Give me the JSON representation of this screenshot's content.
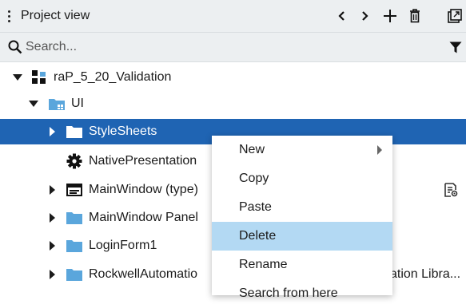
{
  "header": {
    "title": "Project view",
    "actions": [
      "back-icon",
      "forward-icon",
      "add-icon",
      "delete-icon",
      "popout-icon"
    ]
  },
  "search": {
    "placeholder": "Search...",
    "value": ""
  },
  "tree": {
    "items": [
      {
        "label": "raP_5_20_Validation",
        "icon": "project-icon",
        "state": "expanded"
      },
      {
        "label": "UI",
        "icon": "ui-folder-icon",
        "state": "expanded"
      },
      {
        "label": "StyleSheets",
        "icon": "folder-icon",
        "state": "collapsed",
        "selected": true
      },
      {
        "label": "NativePresentation",
        "icon": "gear-icon",
        "state": "leaf"
      },
      {
        "label": "MainWindow (type)",
        "icon": "window-type-icon",
        "state": "collapsed"
      },
      {
        "label": "MainWindow Panel",
        "icon": "folder-icon",
        "state": "collapsed"
      },
      {
        "label": "LoginForm1",
        "icon": "folder-icon",
        "state": "collapsed"
      },
      {
        "label": "RockwellAutomatio",
        "icon": "folder-icon",
        "state": "collapsed"
      }
    ],
    "right_text": "ation Libra..."
  },
  "context_menu": {
    "items": [
      {
        "label": "New",
        "has_submenu": true
      },
      {
        "label": "Copy"
      },
      {
        "label": "Paste"
      },
      {
        "label": "Delete",
        "highlighted": true
      },
      {
        "label": "Rename"
      },
      {
        "label": "Search from here"
      }
    ]
  },
  "colors": {
    "header_bg": "#eceff1",
    "selection": "#1f64b3",
    "menu_highlight": "#b3d9f3",
    "folder": "#5aa6dc"
  }
}
